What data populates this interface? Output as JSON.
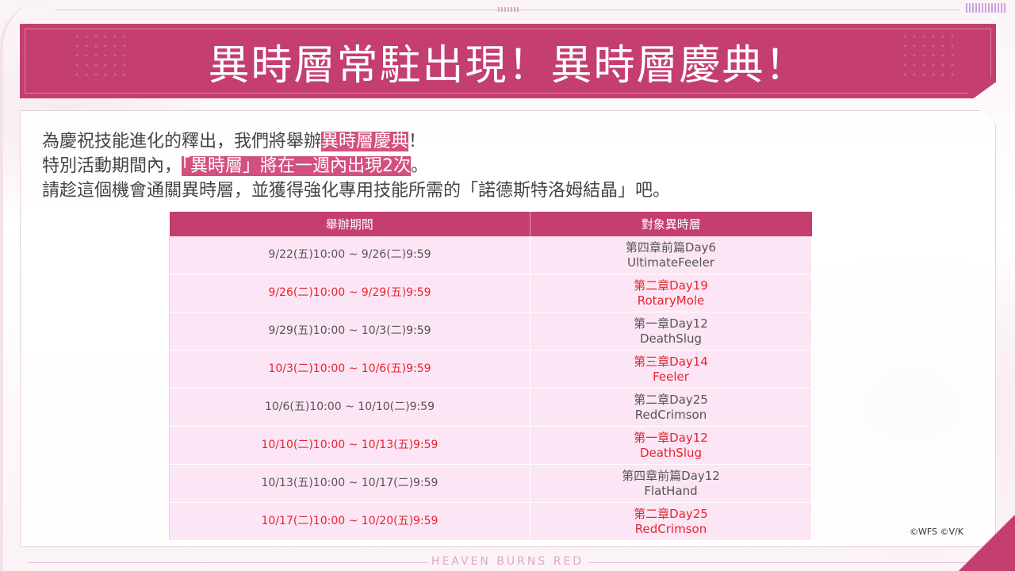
{
  "banner": {
    "title": "異時層常駐出現！異時層慶典！"
  },
  "intro": {
    "line1_pre": "為慶祝技能進化的釋出，我們將舉辦",
    "line1_hl": "異時層慶典",
    "line1_post": "！",
    "line2_pre": "特別活動期間內，",
    "line2_hl": "「異時層」將在一週內出現2次",
    "line2_post": "。",
    "line3": "請趁這個機會通關異時層，並獲得強化專用技能所需的「諾德斯特洛姆結晶」吧。"
  },
  "table": {
    "headers": [
      "舉辦期間",
      "對象異時層"
    ],
    "rows": [
      {
        "period": "9/22(五)10:00 ~ 9/26(二)9:59",
        "chapter": "第四章前篇Day6",
        "target": "UltimateFeeler",
        "highlight": false
      },
      {
        "period": "9/26(二)10:00 ~ 9/29(五)9:59",
        "chapter": "第二章Day19",
        "target": "RotaryMole",
        "highlight": true
      },
      {
        "period": "9/29(五)10:00 ~ 10/3(二)9:59",
        "chapter": "第一章Day12",
        "target": "DeathSlug",
        "highlight": false
      },
      {
        "period": "10/3(二)10:00 ~ 10/6(五)9:59",
        "chapter": "第三章Day14",
        "target": "Feeler",
        "highlight": true
      },
      {
        "period": "10/6(五)10:00 ~ 10/10(二)9:59",
        "chapter": "第二章Day25",
        "target": "RedCrimson",
        "highlight": false
      },
      {
        "period": "10/10(二)10:00 ~ 10/13(五)9:59",
        "chapter": "第一章Day12",
        "target": "DeathSlug",
        "highlight": true
      },
      {
        "period": "10/13(五)10:00 ~ 10/17(二)9:59",
        "chapter": "第四章前篇Day12",
        "target": "FlatHand",
        "highlight": false
      },
      {
        "period": "10/17(二)10:00 ~ 10/20(五)9:59",
        "chapter": "第二章Day25",
        "target": "RedCrimson",
        "highlight": true
      }
    ]
  },
  "footer": {
    "copyright": "©WFS ©V/K",
    "brand": "HEAVEN BURNS RED"
  },
  "colors": {
    "accent": "#c43e70",
    "highlight_text": "#e8242c",
    "cell_bg": "#fce6f5"
  }
}
